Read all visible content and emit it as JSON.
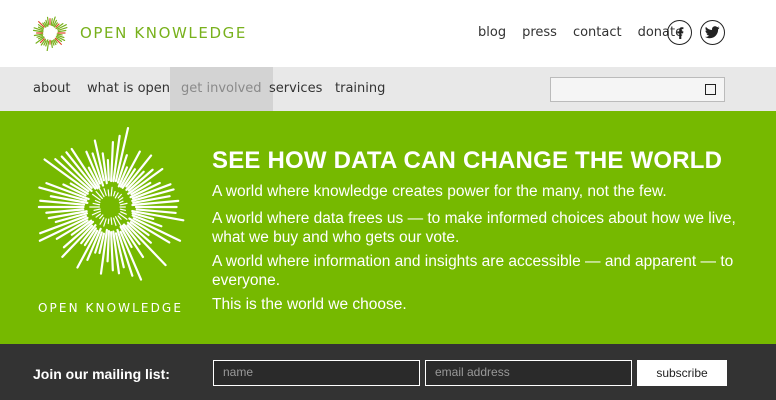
{
  "header": {
    "logo_text": "OPEN KNOWLEDGE",
    "top_links": [
      "blog",
      "press",
      "contact",
      "donate"
    ],
    "social": [
      "facebook-icon",
      "twitter-icon"
    ]
  },
  "nav": {
    "items": [
      "about",
      "what is open?",
      "get involved",
      "services",
      "training"
    ],
    "active": "get involved",
    "search_value": ""
  },
  "hero": {
    "title": "SEE HOW DATA CAN CHANGE THE WORLD",
    "paragraphs": [
      "A world where knowledge creates power for the many, not the few.",
      "A world where data frees us — to make informed choices about how we live, what we buy and who gets our vote.",
      "A world where information and insights are accessible — and apparent — to everyone.",
      "This is the world we choose."
    ],
    "logo_text": "OPEN KNOWLEDGE"
  },
  "mailing": {
    "label": "Join our mailing list:",
    "name_placeholder": "name",
    "email_placeholder": "email address",
    "subscribe_label": "subscribe"
  },
  "colors": {
    "brand_green": "#76b900",
    "logo_green": "#78b11c",
    "accent_red": "#e04a2a",
    "nav_bg": "#e8e8e8",
    "footer_bg": "#333333"
  }
}
